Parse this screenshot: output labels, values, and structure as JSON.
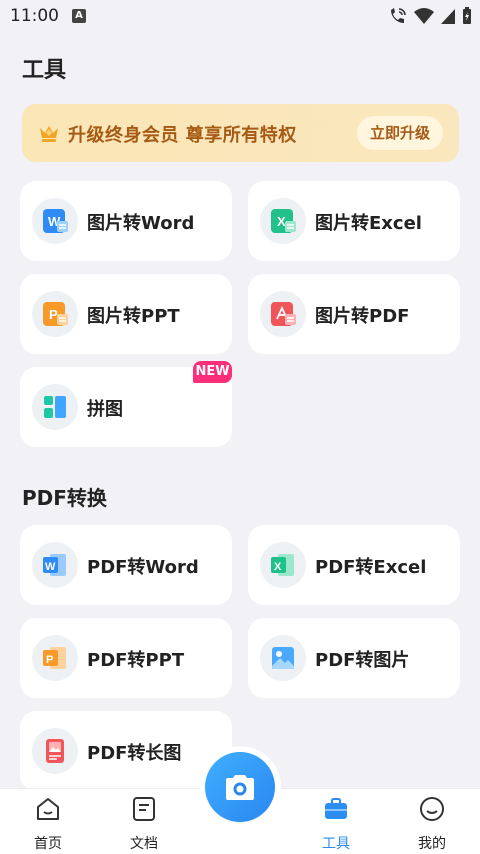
{
  "status_bar": {
    "time": "11:00"
  },
  "page_title": "工具",
  "vip_banner": {
    "text": "升级终身会员 尊享所有特权",
    "button_label": "立即升级"
  },
  "tools": {
    "pic_to_word": "图片转Word",
    "pic_to_excel": "图片转Excel",
    "pic_to_ppt": "图片转PPT",
    "pic_to_pdf": "图片转PDF",
    "collage": "拼图",
    "new_badge": "NEW"
  },
  "pdf_section": {
    "title": "PDF转换",
    "pdf_to_word": "PDF转Word",
    "pdf_to_excel": "PDF转Excel",
    "pdf_to_ppt": "PDF转PPT",
    "pdf_to_image": "PDF转图片",
    "pdf_to_long_image": "PDF转长图"
  },
  "bottom_nav": {
    "home": "首页",
    "docs": "文档",
    "tools": "工具",
    "mine": "我的"
  },
  "colors": {
    "accent": "#2b8ef0",
    "vip_text": "#a65a14",
    "vip_bg": "#fbe6b6",
    "word_blue": "#2f8cf5",
    "excel_green": "#22c08a",
    "ppt_orange": "#f79a2a",
    "pdf_red": "#f0555a",
    "new_badge": "#ff2e7a"
  }
}
